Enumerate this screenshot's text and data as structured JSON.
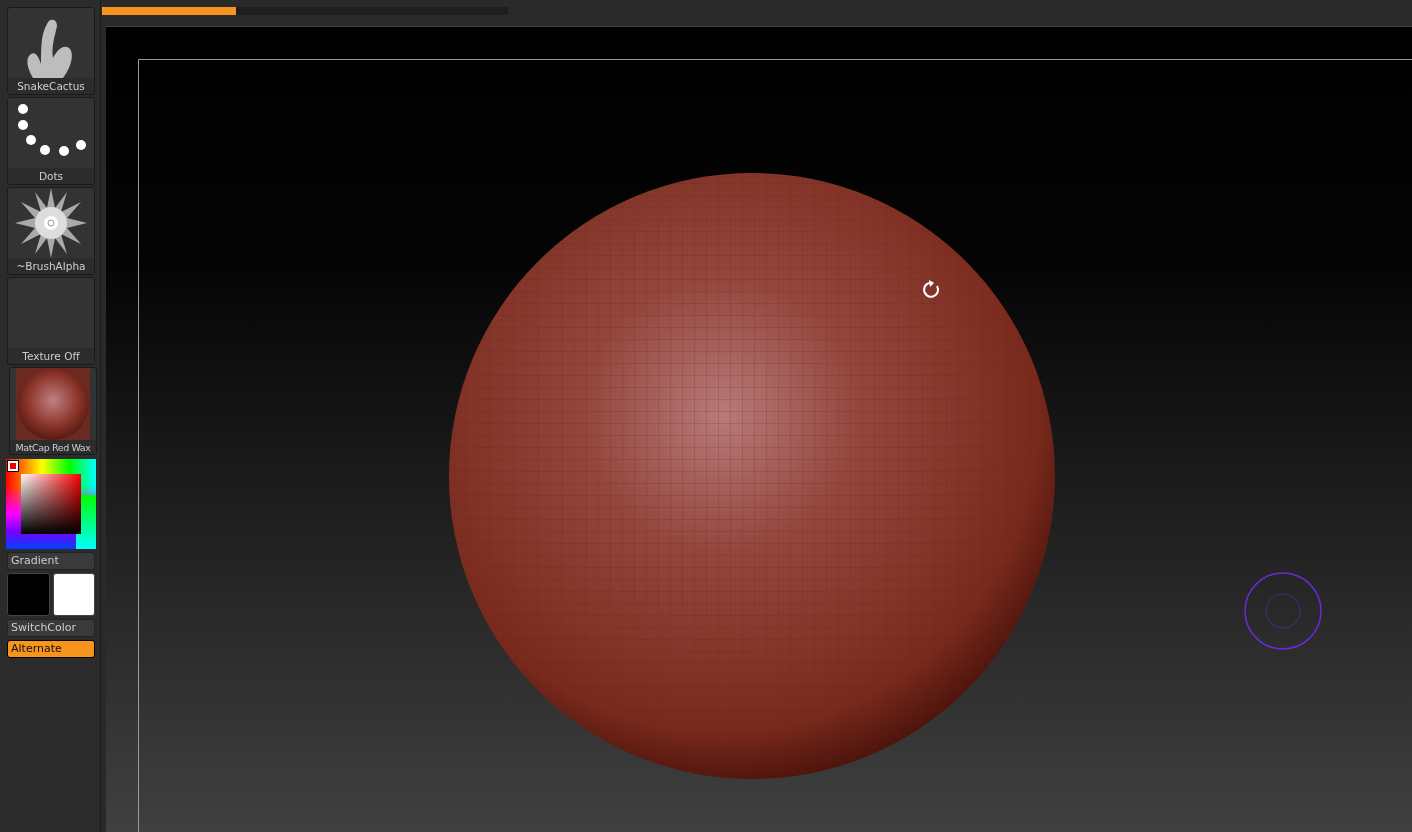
{
  "progress": {
    "level": 0.33
  },
  "thumbnails": [
    {
      "label": "SnakeCactus",
      "kind": "cactus"
    },
    {
      "label": "Dots",
      "kind": "dots"
    },
    {
      "label": "~BrushAlpha",
      "kind": "alpha"
    },
    {
      "label": "Texture Off",
      "kind": "empty"
    },
    {
      "label": "MatCap Red Wax",
      "kind": "material"
    }
  ],
  "gradient_button": "Gradient",
  "switch_color_button": "SwitchColor",
  "alternate_button": {
    "label": "Alternate",
    "on": true
  }
}
